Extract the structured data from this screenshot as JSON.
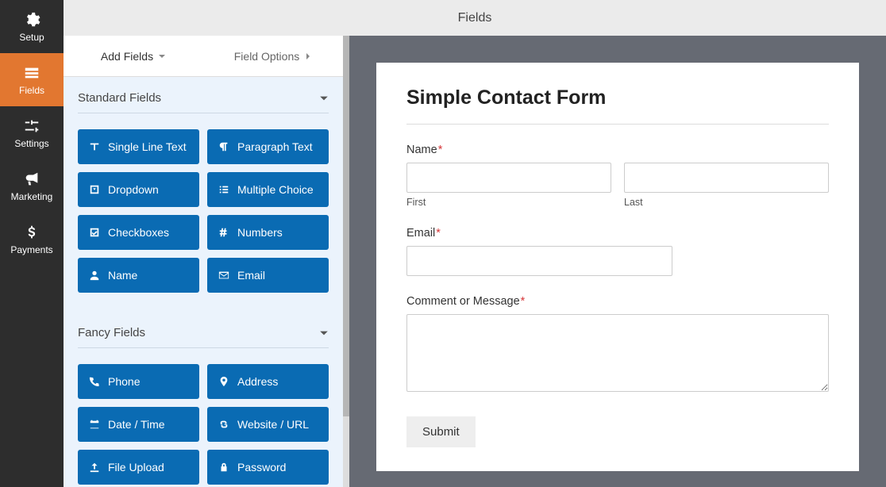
{
  "header": {
    "title": "Fields"
  },
  "nav": {
    "items": [
      {
        "label": "Setup"
      },
      {
        "label": "Fields"
      },
      {
        "label": "Settings"
      },
      {
        "label": "Marketing"
      },
      {
        "label": "Payments"
      }
    ]
  },
  "tabs": {
    "add": "Add Fields",
    "options": "Field Options"
  },
  "sections": {
    "standard": {
      "title": "Standard Fields",
      "fields": [
        {
          "label": "Single Line Text"
        },
        {
          "label": "Paragraph Text"
        },
        {
          "label": "Dropdown"
        },
        {
          "label": "Multiple Choice"
        },
        {
          "label": "Checkboxes"
        },
        {
          "label": "Numbers"
        },
        {
          "label": "Name"
        },
        {
          "label": "Email"
        }
      ]
    },
    "fancy": {
      "title": "Fancy Fields",
      "fields": [
        {
          "label": "Phone"
        },
        {
          "label": "Address"
        },
        {
          "label": "Date / Time"
        },
        {
          "label": "Website / URL"
        },
        {
          "label": "File Upload"
        },
        {
          "label": "Password"
        }
      ]
    }
  },
  "form": {
    "title": "Simple Contact Form",
    "name_label": "Name",
    "first_sub": "First",
    "last_sub": "Last",
    "email_label": "Email",
    "msg_label": "Comment or Message",
    "submit": "Submit"
  }
}
